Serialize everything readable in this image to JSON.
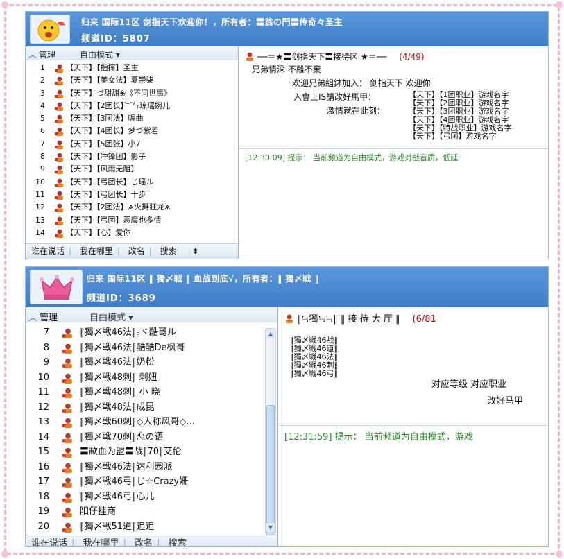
{
  "colors": {
    "header": "#4a88d4",
    "border_pink": "#f2b6c8",
    "tip_green": "#2e8b2e",
    "count_red": "#b00000"
  },
  "panel1": {
    "title": "归来 国际11区 剑指天下欢迎你！，所有者：〓翁の門〓传奇々圣主",
    "channel_id": "频道ID：5807",
    "tab_manage": "管理",
    "tab_mode": "自由模式 ▾",
    "members": [
      {
        "num": "1",
        "name": "【天下】【指挥】圣主"
      },
      {
        "num": "2",
        "name": "【天下】【美女法】夏崇柒"
      },
      {
        "num": "3",
        "name": "【天下】づ甜甜❀《不问世事》"
      },
      {
        "num": "4",
        "name": "【天下】【2团长】︶ㄣ琼瑶婉儿"
      },
      {
        "num": "5",
        "name": "【天下】【3团法】喔曲"
      },
      {
        "num": "6",
        "name": "【天下】【4团长】梦づ紫若"
      },
      {
        "num": "7",
        "name": "【天下】【5团张】小7"
      },
      {
        "num": "8",
        "name": "【天下】【冲锋团】影子"
      },
      {
        "num": "9",
        "name": "【天下】【风雨无阻】"
      },
      {
        "num": "10",
        "name": "【天下】【弓团长】じ瑶ル"
      },
      {
        "num": "11",
        "name": "【天下】【弓团长】十步"
      },
      {
        "num": "12",
        "name": "【天下】【2团法】ѧ火舞狂龙ѧ"
      },
      {
        "num": "13",
        "name": "【天下】【弓团】恶魔也多情"
      },
      {
        "num": "14",
        "name": "【天下】【心】爱你"
      }
    ],
    "bottom": [
      "谁在说话",
      "我在哪里",
      "改名",
      "搜索"
    ],
    "room": "──＝★〓剑指天下〓接待区 ★＝──",
    "count": "(4/49)",
    "board_lines": [
      "兄弟情深  不離不棄",
      "欢迎兄弟組鉢加入：    剑指天下    欢迎你",
      "入會上IS請改好馬甲：",
      "激情就在此刻："
    ],
    "board_list": "【天下】【1团职业】游戏名字\n【天下】【2团职业】游戏名字\n【天下】【3团职业】游戏名字\n【天下】【4团职业】游戏名字\n【天下】【特战职业】游戏名字\n【天下】【弓团】游戏名字",
    "tip": "[12:30:09] 提示： 当前频道为自由模式，游戏对战音质，低延"
  },
  "panel2": {
    "title": "归来 国际11区 ‖ 獨〆戦 ‖ 血战到底√，所有者：‖ 獨〆戦 ‖",
    "channel_id": "频道ID：3689",
    "tab_manage": "管理",
    "tab_mode": "自由模式 ▾",
    "members": [
      {
        "num": "7",
        "name": "‖獨〆戦46法‖ₒヾ酷哥ル"
      },
      {
        "num": "8",
        "name": "‖獨〆戦46法‖酷酷De枫哥"
      },
      {
        "num": "9",
        "name": "‖獨〆戦46法‖奶粉"
      },
      {
        "num": "10",
        "name": "‖獨〆戦48刺‖  刺妞"
      },
      {
        "num": "11",
        "name": "‖獨〆戦48刺‖  小  晓"
      },
      {
        "num": "12",
        "name": "‖獨〆戦48法‖成昆"
      },
      {
        "num": "13",
        "name": "‖獨〆戦60刺‖◇人称风哥◇..."
      },
      {
        "num": "14",
        "name": "‖獨〆戦70刺‖恋の语"
      },
      {
        "num": "15",
        "name": "〓歃血为盟〓战‖70‖艾伦"
      },
      {
        "num": "16",
        "name": "‖獨〆戦46法‖达利园派"
      },
      {
        "num": "17",
        "name": "‖獨〆戦46弓‖じ☆Crazy姍"
      },
      {
        "num": "18",
        "name": "‖獨〆戦46弓‖心儿"
      },
      {
        "num": "19",
        "name": "阳仔挂商"
      },
      {
        "num": "20",
        "name": "‖獨〆戦51道‖追追"
      }
    ],
    "bottom": [
      "谁在说话",
      "我在哪里",
      "改名",
      "搜索"
    ],
    "room": "‖≒獨≒≒‖ ‖ 接 待 大 厅 ‖",
    "count": "(6/81",
    "board_list": "‖獨〆戦46战‖\n‖獨〆戦46道‖\n‖獨〆戦46法‖\n‖獨〆戦46刺‖\n‖獨〆戦46弓‖",
    "board_line1": "对应等级   对应职业",
    "board_line2": "改好马甲",
    "tip": "[12:31:59] 提示： 当前频道为自由模式，游戏"
  }
}
